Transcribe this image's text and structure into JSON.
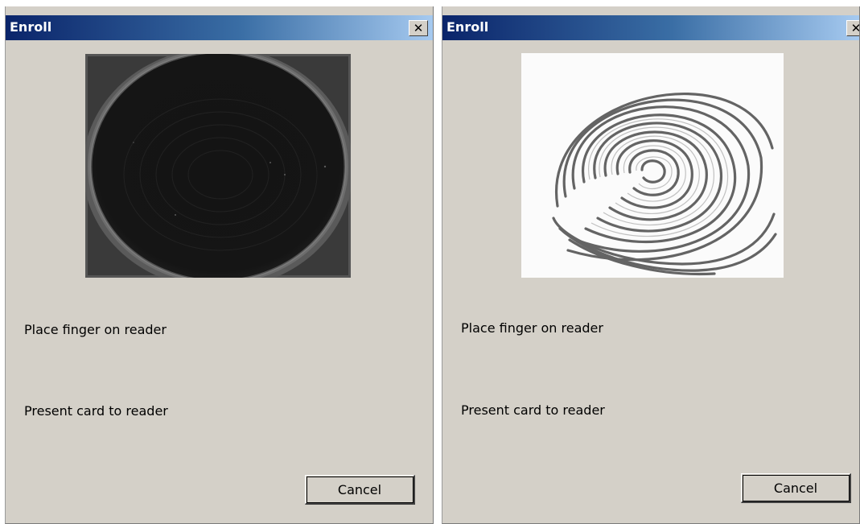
{
  "windows": [
    {
      "title": "Enroll",
      "close_symbol": "✕",
      "image": {
        "kind": "fingerprint-scan-dark",
        "description_icon": "fingerprint-sensor-preview"
      },
      "messages": [
        "Place finger on reader",
        "Present card to reader"
      ],
      "cancel_label": "Cancel"
    },
    {
      "title": "Enroll",
      "close_symbol": "✕",
      "image": {
        "kind": "fingerprint-scan-processed",
        "description_icon": "fingerprint-image"
      },
      "messages": [
        "Place finger on reader",
        "Present card to reader"
      ],
      "cancel_label": "Cancel"
    }
  ],
  "colors": {
    "dialog_bg": "#d4d0c8",
    "titlebar_start": "#0a246a",
    "titlebar_end": "#a6caf0",
    "title_text": "#ffffff"
  }
}
